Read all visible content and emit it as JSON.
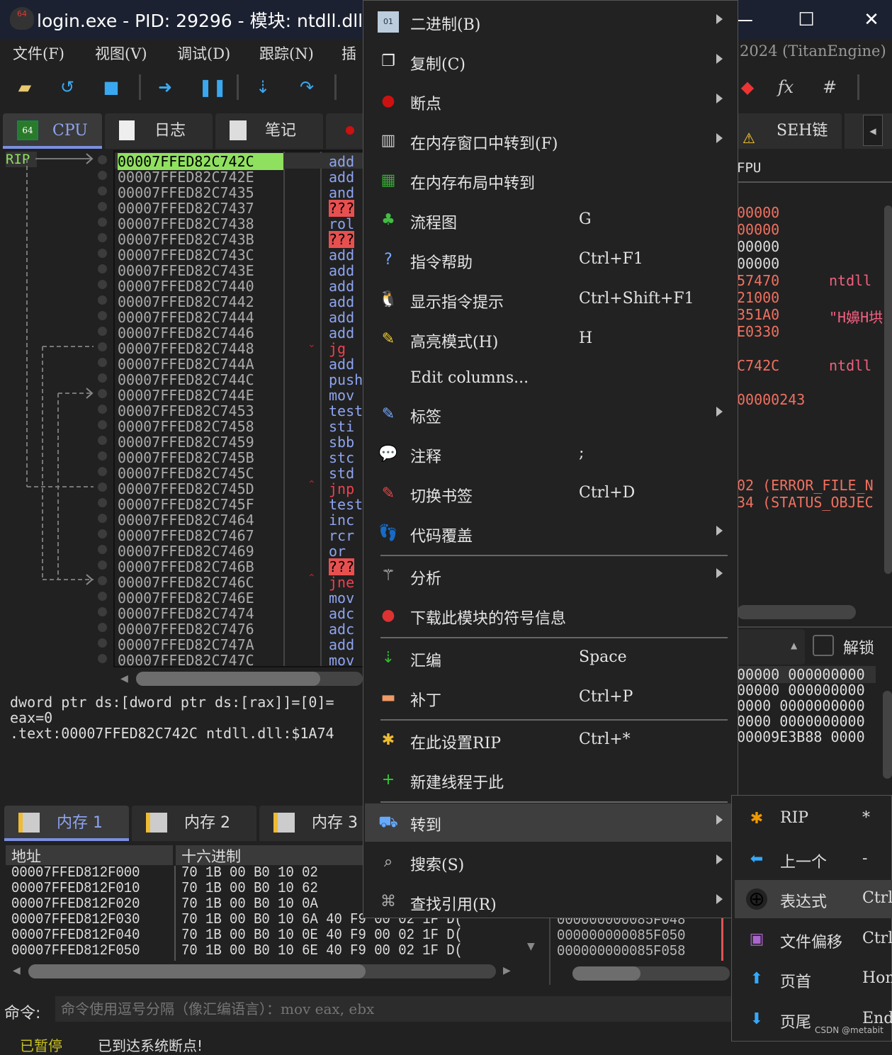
{
  "window": {
    "title": "login.exe - PID: 29296 - 模块: ntdll.dll - 线",
    "title_suffix": "2024 (TitanEngine)"
  },
  "menubar": [
    "文件(F)",
    "视图(V)",
    "调试(D)",
    "跟踪(N)",
    "插"
  ],
  "toolbar": {
    "icons": [
      "open-folder",
      "restart",
      "stop",
      "run",
      "pause",
      "step-into",
      "step-over",
      "trace",
      "patch",
      "expression-fx",
      "hash"
    ],
    "fx": "fx",
    "hash": "#"
  },
  "tabs": [
    {
      "label": "CPU",
      "active": true
    },
    {
      "label": "日志"
    },
    {
      "label": "笔记"
    },
    {
      "label": "SEH链"
    }
  ],
  "disasm": {
    "rip_label": "RIP",
    "addresses": [
      "00007FFED82C742C",
      "00007FFED82C742E",
      "00007FFED82C7435",
      "00007FFED82C7437",
      "00007FFED82C7438",
      "00007FFED82C743B",
      "00007FFED82C743C",
      "00007FFED82C743E",
      "00007FFED82C7440",
      "00007FFED82C7442",
      "00007FFED82C7444",
      "00007FFED82C7446",
      "00007FFED82C7448",
      "00007FFED82C744A",
      "00007FFED82C744C",
      "00007FFED82C744E",
      "00007FFED82C7453",
      "00007FFED82C7458",
      "00007FFED82C7459",
      "00007FFED82C745B",
      "00007FFED82C745C",
      "00007FFED82C745D",
      "00007FFED82C745F",
      "00007FFED82C7464",
      "00007FFED82C7467",
      "00007FFED82C7469",
      "00007FFED82C746B",
      "00007FFED82C746C",
      "00007FFED82C746E",
      "00007FFED82C7474",
      "00007FFED82C7476",
      "00007FFED82C747A",
      "00007FFED82C747C"
    ],
    "mnemonics": [
      "add",
      "add",
      "and",
      "???",
      "rol",
      "???",
      "add",
      "add",
      "add",
      "add",
      "add",
      "add",
      "jg",
      "add",
      "push",
      "mov",
      "test",
      "sti",
      "sbb",
      "stc",
      "std",
      "jnp",
      "test",
      "inc",
      "rcr",
      "or",
      "???",
      "jne",
      "mov",
      "adc",
      "adc",
      "add",
      "mov"
    ],
    "colors": {
      "rip_row": "#90e060",
      "mnemonic": "#8ea4f0",
      "jump": "#f04050",
      "invalid_bg": "#e85050"
    }
  },
  "info": {
    "lines": [
      "dword ptr ds:[dword ptr ds:[rax]]=[0]=",
      "eax=0",
      "",
      ".text:00007FFED82C742C ntdll.dll:$1A74"
    ]
  },
  "registers": {
    "header": "FPU",
    "values": [
      "00000",
      "00000",
      "00000",
      "00000",
      "57470",
      "21000",
      "351A0",
      "E0330",
      "",
      "C742C",
      "",
      "00000243"
    ],
    "comments": [
      "",
      "",
      "",
      "",
      "ntdll",
      "",
      "\"H嬶H垬",
      "",
      "",
      "ntdll",
      "",
      ""
    ],
    "errors": [
      "02 (ERROR_FILE_N",
      "34 (STATUS_OBJEC"
    ]
  },
  "stack_args": {
    "unlock_label": "解锁",
    "rows": [
      "00000 000000000",
      "00000 000000000",
      "0000 0000000000",
      "0000 0000000000",
      "00009E3B88 0000"
    ]
  },
  "memtabs": [
    "内存 1",
    "内存 2",
    "内存 3"
  ],
  "dump": {
    "headers": [
      "地址",
      "十六进制"
    ],
    "rows": [
      {
        "addr": "00007FFED812F000",
        "hex": "70  1B  00  B0  10  02"
      },
      {
        "addr": "00007FFED812F010",
        "hex": "70  1B  00  B0  10  62"
      },
      {
        "addr": "00007FFED812F020",
        "hex": "70  1B  00  B0  10  0A"
      },
      {
        "addr": "00007FFED812F030",
        "hex": "70  1B  00  B0  10  6A  40  F9  00  02  1F  D("
      },
      {
        "addr": "00007FFED812F040",
        "hex": "70  1B  00  B0  10  0E  40  F9  00  02  1F  D("
      },
      {
        "addr": "00007FFED812F050",
        "hex": "70  1B  00  B0  10  6E  40  F9  00  02  1F  D("
      }
    ]
  },
  "stack": [
    "000000000085F048",
    "000000000085F050",
    "000000000085F058"
  ],
  "command": {
    "label": "命令:",
    "placeholder": "命令使用逗号分隔（像汇编语言）：mov eax, ebx"
  },
  "status": {
    "state": "已暂停",
    "message": "已到达系统断点!"
  },
  "context_menu": [
    {
      "label": "二进制(B)",
      "icon": "binary-icon",
      "submenu": true
    },
    {
      "label": "复制(C)",
      "icon": "copy-icon",
      "submenu": true
    },
    {
      "label": "断点",
      "icon": "breakpoint-icon",
      "submenu": true
    },
    {
      "label": "在内存窗口中转到(F)",
      "icon": "memory-icon",
      "submenu": true
    },
    {
      "label": "在内存布局中转到",
      "icon": "memory-map-icon"
    },
    {
      "label": "流程图",
      "icon": "graph-icon",
      "shortcut": "G"
    },
    {
      "label": "指令帮助",
      "icon": "help-icon",
      "shortcut": "Ctrl+F1"
    },
    {
      "label": "显示指令提示",
      "icon": "tux-icon",
      "shortcut": "Ctrl+Shift+F1"
    },
    {
      "label": "高亮模式(H)",
      "icon": "highlight-icon",
      "shortcut": "H"
    },
    {
      "label": "Edit columns...",
      "icon": ""
    },
    {
      "label": "标签",
      "icon": "label-icon",
      "submenu": true
    },
    {
      "label": "注释",
      "icon": "comment-icon",
      "shortcut": ";"
    },
    {
      "label": "切换书签",
      "icon": "bookmark-icon",
      "shortcut": "Ctrl+D"
    },
    {
      "label": "代码覆盖",
      "icon": "footprint-icon",
      "submenu": true,
      "sep_after": true
    },
    {
      "label": "分析",
      "icon": "wand-icon",
      "submenu": true
    },
    {
      "label": "下载此模块的符号信息",
      "icon": "symbol-download-icon",
      "sep_after": true
    },
    {
      "label": "汇编",
      "icon": "assemble-icon",
      "shortcut": "Space"
    },
    {
      "label": "补丁",
      "icon": "patch-icon",
      "shortcut": "Ctrl+P",
      "sep_after": true
    },
    {
      "label": "在此设置RIP",
      "icon": "set-rip-icon",
      "shortcut": "Ctrl+*"
    },
    {
      "label": "新建线程于此",
      "icon": "new-thread-icon",
      "sep_after": true
    },
    {
      "label": "转到",
      "icon": "goto-icon",
      "submenu": true,
      "highlighted": true
    },
    {
      "label": "搜索(S)",
      "icon": "search-icon",
      "submenu": true
    },
    {
      "label": "查找引用(R)",
      "icon": "binoculars-icon",
      "submenu": true
    }
  ],
  "goto_submenu": [
    {
      "label": "RIP",
      "shortcut": "*",
      "icon": "rip-star-icon"
    },
    {
      "label": "上一个",
      "shortcut": "-",
      "icon": "arrow-left-icon"
    },
    {
      "label": "表达式",
      "shortcut": "Ctrl",
      "icon": "crosshair-icon",
      "highlighted": true
    },
    {
      "label": "文件偏移",
      "shortcut": "Ctrl",
      "icon": "save-file-icon"
    },
    {
      "label": "页首",
      "shortcut": "Home",
      "icon": "arrow-up-icon"
    },
    {
      "label": "页尾",
      "shortcut": "End",
      "icon": "arrow-down-icon"
    }
  ],
  "watermark": "CSDN @metabit"
}
